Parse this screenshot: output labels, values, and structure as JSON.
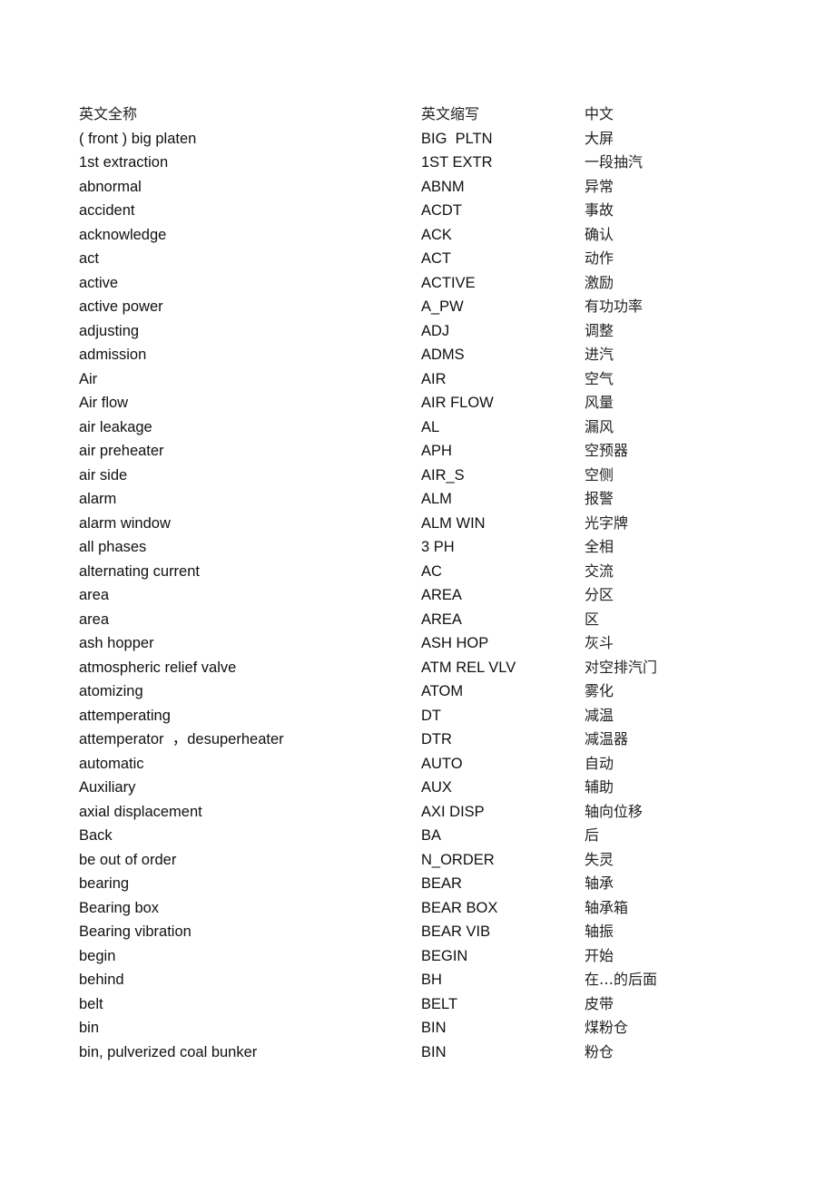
{
  "document": {
    "headers": {
      "full_name": "英文全称",
      "abbreviation": "英文缩写",
      "chinese": "中文"
    },
    "rows": [
      {
        "full": "( front ) big platen",
        "abbr": "BIG  PLTN",
        "cn": "大屏"
      },
      {
        "full": "1st extraction",
        "abbr": "1ST EXTR",
        "cn": "一段抽汽"
      },
      {
        "full": "abnormal",
        "abbr": "ABNM",
        "cn": "异常"
      },
      {
        "full": "accident",
        "abbr": "ACDT",
        "cn": "事故"
      },
      {
        "full": "acknowledge",
        "abbr": "ACK",
        "cn": "确认"
      },
      {
        "full": "act",
        "abbr": "ACT",
        "cn": "动作"
      },
      {
        "full": "active",
        "abbr": "ACTIVE",
        "cn": "激励"
      },
      {
        "full": "active power",
        "abbr": "A_PW",
        "cn": "有功功率"
      },
      {
        "full": "adjusting",
        "abbr": "ADJ",
        "cn": "调整"
      },
      {
        "full": "admission",
        "abbr": "ADMS",
        "cn": "进汽"
      },
      {
        "full": "Air",
        "abbr": "AIR",
        "cn": "空气"
      },
      {
        "full": "Air flow",
        "abbr": "AIR FLOW",
        "cn": "风量"
      },
      {
        "full": "air leakage",
        "abbr": "AL",
        "cn": "漏风"
      },
      {
        "full": "air preheater",
        "abbr": "APH",
        "cn": "空预器"
      },
      {
        "full": "air side",
        "abbr": "AIR_S",
        "cn": "空侧"
      },
      {
        "full": "alarm",
        "abbr": "ALM",
        "cn": "报警"
      },
      {
        "full": "alarm window",
        "abbr": "ALM WIN",
        "cn": "光字牌"
      },
      {
        "full": "all phases",
        "abbr": "3 PH",
        "cn": "全相"
      },
      {
        "full": "alternating current",
        "abbr": "AC",
        "cn": "交流"
      },
      {
        "full": "area",
        "abbr": "AREA",
        "cn": "分区"
      },
      {
        "full": "area",
        "abbr": "AREA",
        "cn": "区"
      },
      {
        "full": "ash hopper",
        "abbr": "ASH HOP",
        "cn": "灰斗"
      },
      {
        "full": "atmospheric relief valve",
        "abbr": "ATM REL VLV",
        "cn": "对空排汽门"
      },
      {
        "full": "atomizing",
        "abbr": "ATOM",
        "cn": "雾化"
      },
      {
        "full": "attemperating",
        "abbr": "DT",
        "cn": "减温"
      },
      {
        "full": "attemperator  ，desuperheater",
        "abbr": "DTR",
        "cn": "减温器"
      },
      {
        "full": "automatic",
        "abbr": "AUTO",
        "cn": "自动"
      },
      {
        "full": "Auxiliary",
        "abbr": "AUX",
        "cn": "辅助"
      },
      {
        "full": "axial displacement",
        "abbr": "AXI DISP",
        "cn": "轴向位移"
      },
      {
        "full": "Back",
        "abbr": "BA",
        "cn": "后"
      },
      {
        "full": "be out of order",
        "abbr": "N_ORDER",
        "cn": "失灵"
      },
      {
        "full": "bearing",
        "abbr": "BEAR",
        "cn": "轴承"
      },
      {
        "full": "Bearing box",
        "abbr": "BEAR BOX",
        "cn": "轴承箱"
      },
      {
        "full": "Bearing vibration",
        "abbr": "BEAR VIB",
        "cn": "轴振"
      },
      {
        "full": "begin",
        "abbr": "BEGIN",
        "cn": "开始"
      },
      {
        "full": "behind",
        "abbr": "BH",
        "cn": "在…的后面"
      },
      {
        "full": "belt",
        "abbr": "BELT",
        "cn": "皮带"
      },
      {
        "full": "bin",
        "abbr": "BIN",
        "cn": "煤粉仓"
      },
      {
        "full": "bin, pulverized coal bunker",
        "abbr": "BIN",
        "cn": "粉仓"
      }
    ]
  }
}
